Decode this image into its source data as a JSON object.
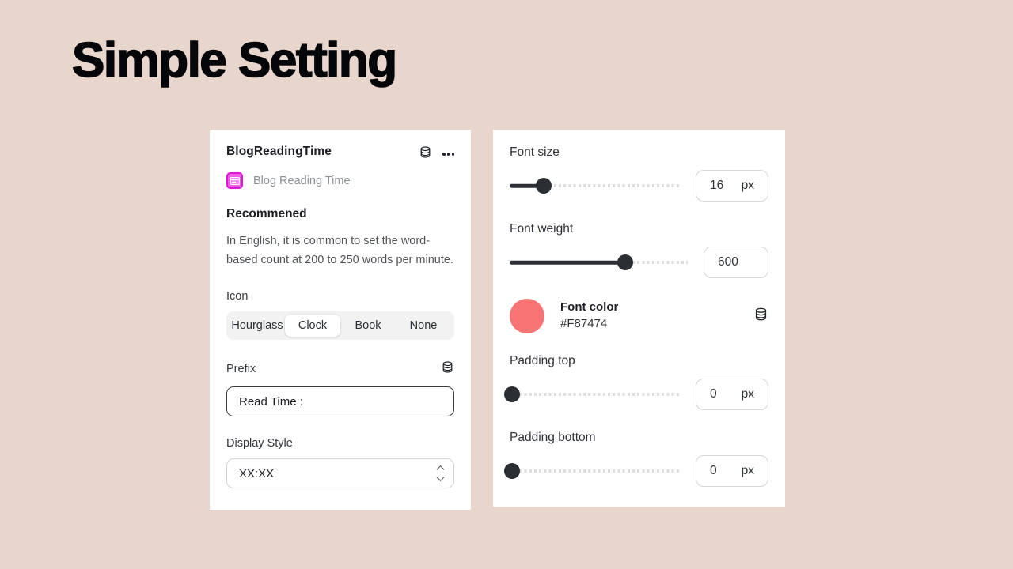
{
  "page": {
    "title": "Simple Setting",
    "background_color": "#E8D5CC"
  },
  "left_panel": {
    "card_title": "BlogReadingTime",
    "header_icons": {
      "database": "database-icon",
      "more": "more-options-icon"
    },
    "app_icon": "blog-reading-time-app-icon",
    "subtitle": "Blog Reading Time",
    "section_heading": "Recommened",
    "description": "In English, it is common to set the word-based count at 200 to 250 words per minute.",
    "icon_field": {
      "label": "Icon",
      "options": [
        "Hourglass",
        "Clock",
        "Book",
        "None"
      ],
      "selected": "Clock"
    },
    "prefix_field": {
      "label": "Prefix",
      "value": "Read Time :",
      "placeholder": "Read Time :",
      "icon": "database-icon"
    },
    "display_style_field": {
      "label": "Display Style",
      "value": "XX:XX",
      "options": [
        "XX:XX"
      ]
    }
  },
  "right_panel": {
    "font_size": {
      "label": "Font size",
      "value": "16",
      "unit": "px",
      "percent": 20
    },
    "font_weight": {
      "label": "Font weight",
      "value": "600",
      "unit": "",
      "percent": 65
    },
    "font_color": {
      "label": "Font color",
      "hex": "#F87474",
      "icon": "database-icon"
    },
    "padding_top": {
      "label": "Padding top",
      "value": "0",
      "unit": "px",
      "percent": 0
    },
    "padding_bottom": {
      "label": "Padding bottom",
      "value": "0",
      "unit": "px",
      "percent": 0
    }
  }
}
